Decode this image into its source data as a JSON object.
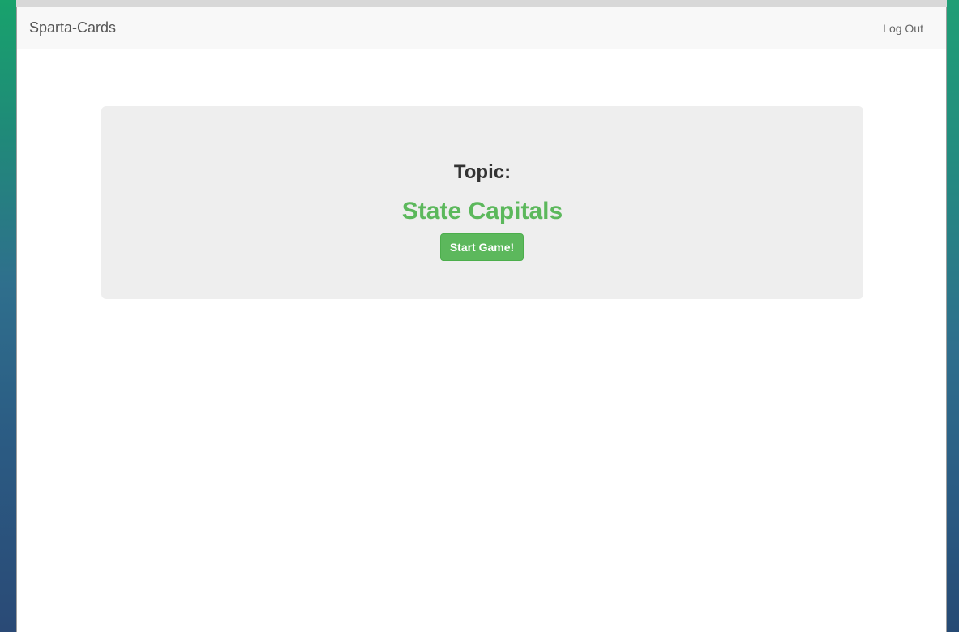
{
  "navbar": {
    "brand": "Sparta-Cards",
    "logout_label": "Log Out"
  },
  "topic": {
    "label": "Topic:",
    "name": "State Capitals"
  },
  "actions": {
    "start_label": "Start Game!"
  },
  "colors": {
    "accent": "#5cb85c",
    "navbar_bg": "#f8f8f8",
    "panel_bg": "#eeeeee"
  }
}
